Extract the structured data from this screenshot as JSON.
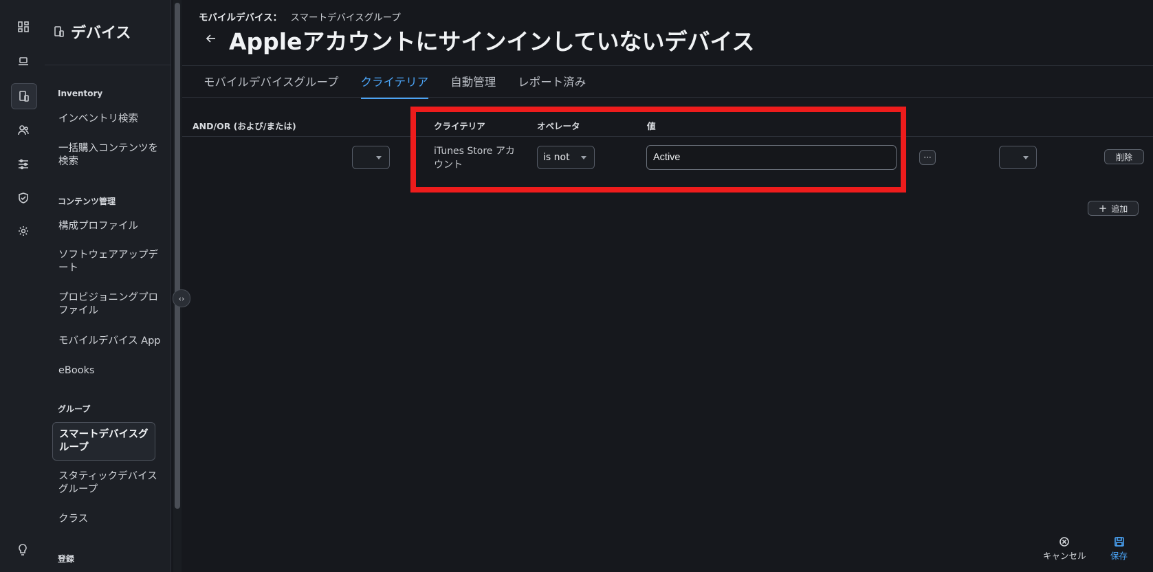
{
  "rail": {
    "icons": [
      "dashboard-icon",
      "laptop-icon",
      "mobile-devices-icon",
      "users-icon",
      "sliders-icon",
      "shield-check-icon",
      "gear-icon"
    ],
    "active_index": 2
  },
  "sidebar": {
    "title": "デバイス",
    "sections": [
      {
        "label": "Inventory",
        "items": [
          "インベントリ検索",
          "一括購入コンテンツを検索"
        ]
      },
      {
        "label": "コンテンツ管理",
        "items": [
          "構成プロファイル",
          "ソフトウェアアップデート",
          "プロビジョニングプロファイル",
          "モバイルデバイス App",
          "eBooks"
        ]
      },
      {
        "label": "グループ",
        "items": [
          "スマートデバイスグループ",
          "スタティックデバイスグループ",
          "クラス"
        ]
      },
      {
        "label": "登録",
        "items": []
      }
    ],
    "active_item": "スマートデバイスグループ"
  },
  "breadcrumb": {
    "parent": "モバイルデバイス：",
    "current": "スマートデバイスグループ"
  },
  "page_title": "Appleアカウントにサインインしていないデバイス",
  "tabs": [
    {
      "label": "モバイルデバイスグループ",
      "active": false
    },
    {
      "label": "クライテリア",
      "active": true
    },
    {
      "label": "自動管理",
      "active": false
    },
    {
      "label": "レポート済み",
      "active": false
    }
  ],
  "table": {
    "headers": {
      "andor": "AND/OR (および/または)",
      "criteria": "クライテリア",
      "operator": "オペレータ",
      "value": "値"
    },
    "row": {
      "andor": "",
      "criteria": "iTunes Store アカウント",
      "operator": "is not",
      "value": "Active",
      "paren": ""
    },
    "more_label": "···",
    "delete_label": "削除",
    "add_label": "追加"
  },
  "footer": {
    "cancel": "キャンセル",
    "save": "保存"
  },
  "colors": {
    "accent": "#4aa3f5",
    "highlight": "#ee1c1c",
    "background": "#16181d",
    "sidebar": "#1c1f25"
  }
}
